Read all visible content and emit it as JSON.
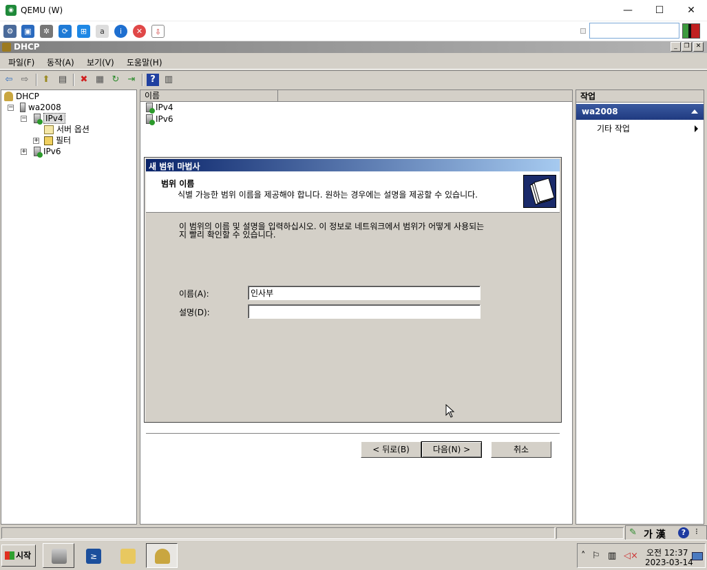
{
  "qemu": {
    "title": "QEMU (W)",
    "minimize": "—",
    "maximize": "☐",
    "close": "✕"
  },
  "mmc": {
    "title": "DHCP",
    "menu": [
      "파일(F)",
      "동작(A)",
      "보기(V)",
      "도움말(H)"
    ]
  },
  "tree": {
    "root": "DHCP",
    "server": "wa2008",
    "ipv4": "IPv4",
    "server_options": "서버 옵션",
    "filters": "필터",
    "ipv6": "IPv6"
  },
  "list": {
    "column_name": "이름",
    "rows": [
      "IPv4",
      "IPv6"
    ]
  },
  "actions": {
    "header": "작업",
    "section": "wa2008",
    "more": "기타 작업"
  },
  "wizard": {
    "title": "새 범위 마법사",
    "heading": "범위 이름",
    "subheading": "식별 가능한 범위 이름을 제공해야 합니다. 원하는 경우에는 설명을 제공할 수 있습니다.",
    "body_line1": "이 범위의 이름 및 설명을 입력하십시오. 이 정보로 네트워크에서 범위가 어떻게 사용되는",
    "body_line2": "지 빨리 확인할 수 있습니다.",
    "name_label": "이름(A):",
    "name_value": "인사부",
    "desc_label": "설명(D):",
    "desc_value": "",
    "back": "< 뒤로(B)",
    "next": "다음(N) >",
    "cancel": "취소"
  },
  "ime": {
    "text": "가 漢"
  },
  "taskbar": {
    "start": "시작",
    "time": "오전 12:37",
    "date": "2023-03-14"
  }
}
